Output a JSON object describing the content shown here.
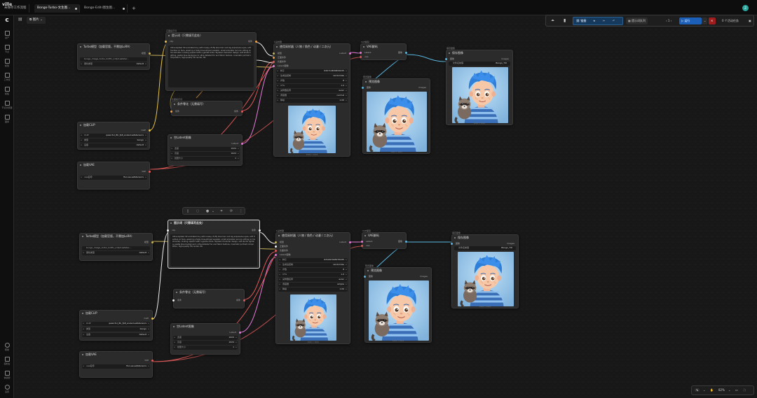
{
  "app": {
    "logo": "ville"
  },
  "tabs": [
    {
      "label": "未保存工作流程"
    },
    {
      "label": "Bongo-Turbo-文生图..."
    },
    {
      "label": "Bongo-Edit-图生图..."
    }
  ],
  "tab_add": "+",
  "user_initial": "Z",
  "sidebar": {
    "items": [
      {
        "label": "资产",
        "icon": "assets-icon"
      },
      {
        "label": "节点",
        "icon": "nodes-icon"
      },
      {
        "label": "模型",
        "icon": "models-icon"
      },
      {
        "label": "工作流",
        "icon": "workflows-icon"
      },
      {
        "label": "模板",
        "icon": "templates-icon"
      },
      {
        "label": "节点浏览器",
        "icon": "node-browser-icon"
      },
      {
        "label": "图库",
        "icon": "gallery-icon"
      }
    ],
    "bottom": [
      {
        "label": "帮助",
        "icon": "help-icon"
      },
      {
        "label": "控制台",
        "icon": "console-icon"
      },
      {
        "label": "快捷键",
        "icon": "keyboard-icon"
      },
      {
        "label": "设置",
        "icon": "settings-icon"
      }
    ]
  },
  "workflow_chip": "图片",
  "toolbar": {
    "share_label": "链接",
    "queue_label": "提示词队列",
    "count": "1",
    "run_label": "运行",
    "tasks_label": "0 个活动任务"
  },
  "colors": {
    "model_link": "#c7b25a",
    "clip_link": "#e7c34a",
    "conditioning_link": "#f0f0f0",
    "latent_link": "#e57bd6",
    "vae_link": "#e05a5a",
    "image_link": "#5ab7e0"
  },
  "workflow_top": {
    "model_loader": {
      "sub": "",
      "title": "Turbo模型（加载官版，不需加LoRA）",
      "out_model": "模型",
      "widgets": [
        {
          "label": "bongo_image_turbo_hotfix_nvfp4.safeter..."
        },
        {
          "label": "量化类型",
          "value": "default"
        }
      ]
    },
    "clip_loader": {
      "sub": "",
      "title": "加载CLIP",
      "out": "CLIP",
      "widgets": [
        {
          "label": "CLIP",
          "value": "qwen3vl_8b_fp8_scaled.safetensors"
        },
        {
          "label": "类型",
          "value": "bongo"
        },
        {
          "label": "设备",
          "value": "default"
        }
      ]
    },
    "vae_loader": {
      "sub": "",
      "title": "加载VAE",
      "out": "VAE",
      "widgets": [
        {
          "label": "vae名称",
          "value": "flux-ae.safetensors"
        }
      ]
    },
    "prompt": {
      "sub": "正面提示词",
      "title": "提示词（只需填写此处）",
      "in_clip": "clip",
      "out": "条件",
      "text": "Ultra-stylized 3D animated boy with messy, fluffy blue hair and big expressive eyes, soft freckles on face, wearing a fuzzy blue-striped sweater, small adorable raccoon sitting on his shoulder, looking upward with a gentle smile. Stylized character design, soft studio lighting, pastel blue background, ultra-detailed fur and fabric texture, cinematic portrait composition, high-quality 3D render, 8K"
    },
    "zero_out": {
      "sub": "负面提示词",
      "title": "条件零化（无需填写）",
      "in": "条件",
      "out": "条件"
    },
    "empty_latent": {
      "sub": "",
      "title": "空Latent图像",
      "out": "Latent",
      "widgets": [
        {
          "label": "宽度",
          "value": "1024"
        },
        {
          "label": "高度",
          "value": "1024"
        },
        {
          "label": "批量大小",
          "value": "1"
        }
      ]
    },
    "ksampler": {
      "sub": "K采样器",
      "title": "使用采样器（人物 / 角色 / 动漫 / 二次元）",
      "inputs": [
        "模型",
        "正面条件",
        "负面条件",
        "Latent图像"
      ],
      "out": "Latent",
      "widgets": [
        {
          "label": "种子",
          "value": "630714830652035"
        },
        {
          "label": "生成后控制",
          "value": "randomize"
        },
        {
          "label": "步数",
          "value": "8"
        },
        {
          "label": "CFG",
          "value": "1.0"
        },
        {
          "label": "采样器名称",
          "value": "euler"
        },
        {
          "label": "调度器",
          "value": "normal"
        },
        {
          "label": "降噪",
          "value": "1.00"
        }
      ],
      "caption": "1024 × 1024"
    },
    "vae_decode": {
      "sub": "VAE解码",
      "title": "VAE解码",
      "inputs": [
        "Latent",
        "vae"
      ],
      "out": "图像"
    },
    "preview": {
      "sub": "预览图像",
      "title": "预览图像",
      "in": "图像",
      "out": "images",
      "caption": "1024 × 1024"
    },
    "save": {
      "sub": "保存图像",
      "title": "保存图像",
      "in": "图像",
      "out": "images",
      "widget": {
        "label": "文件名前缀",
        "value": "Bongo_T2I"
      },
      "caption": "1024 × 1024"
    }
  },
  "workflow_bottom": {
    "model_loader": {
      "title": "Turbo模型（加载官版，不需加LoRA）",
      "out_model": "模型",
      "widgets": [
        {
          "label": "bongo_image_turbo_hotfix_nvfp4.safeter..."
        },
        {
          "label": "量化类型",
          "value": "default"
        }
      ]
    },
    "clip_loader": {
      "title": "加载CLIP",
      "out": "CLIP",
      "widgets": [
        {
          "label": "CLIP",
          "value": "qwen3vl_8b_fp8_scaled.safetensors"
        },
        {
          "label": "类型",
          "value": "bongo"
        },
        {
          "label": "设备",
          "value": "default"
        }
      ]
    },
    "vae_loader": {
      "title": "加载VAE",
      "out": "VAE",
      "widgets": [
        {
          "label": "vae名称",
          "value": "flux-ae.safetensors"
        }
      ]
    },
    "prompt": {
      "title": "提示词（只需填写此处）",
      "in_clip": "clip",
      "out": "条件",
      "text": "Ultra-stylized 3D animated boy with messy, fluffy blue hair and big expressive eyes, soft freckles on face, wearing a fuzzy blue-striped sweater, small adorable raccoon sitting on his shoulder, looking upward with a gentle smile. Stylized character design, soft studio lighting, pastel blue background, ultra-detailed fur and fabric texture, cinematic portrait composition, high-quality 3D render, 8K"
    },
    "zero_out": {
      "title": "条件零化（无需填写）",
      "in": "条件",
      "out": "条件"
    },
    "empty_latent": {
      "title": "空Latent图像",
      "out": "Latent",
      "widgets": [
        {
          "label": "宽度",
          "value": "1024"
        },
        {
          "label": "高度",
          "value": "1024"
        },
        {
          "label": "批量大小",
          "value": "1"
        }
      ]
    },
    "ksampler": {
      "sub": "K采样器",
      "title": "使用采样器（人物 / 角色 / 动漫 / 二次元）",
      "inputs": [
        "模型",
        "正面条件",
        "负面条件",
        "Latent图像"
      ],
      "out": "Latent",
      "widgets": [
        {
          "label": "种子",
          "value": "631097463075435"
        },
        {
          "label": "生成后控制",
          "value": "randomize"
        },
        {
          "label": "步数",
          "value": "8"
        },
        {
          "label": "CFG",
          "value": "1.0"
        },
        {
          "label": "采样器名称",
          "value": "euler"
        },
        {
          "label": "调度器",
          "value": "simple"
        },
        {
          "label": "降噪",
          "value": "1.00"
        }
      ],
      "caption": "1024 × 1024"
    },
    "vae_decode": {
      "sub": "VAE解码",
      "title": "VAE解码",
      "inputs": [
        "Latent",
        "vae"
      ],
      "out": "图像"
    },
    "preview": {
      "sub": "预览图像",
      "title": "预览图像",
      "in": "图像",
      "out": "images",
      "caption": "1024 × 1024"
    },
    "save": {
      "sub": "保存图像",
      "title": "保存图像",
      "in": "图像",
      "out": "images",
      "widget": {
        "label": "文件名前缀",
        "value": "Bongo_T2I"
      },
      "caption": "1024 × 1024"
    }
  },
  "canvas_controls": {
    "zoom": "82%"
  }
}
